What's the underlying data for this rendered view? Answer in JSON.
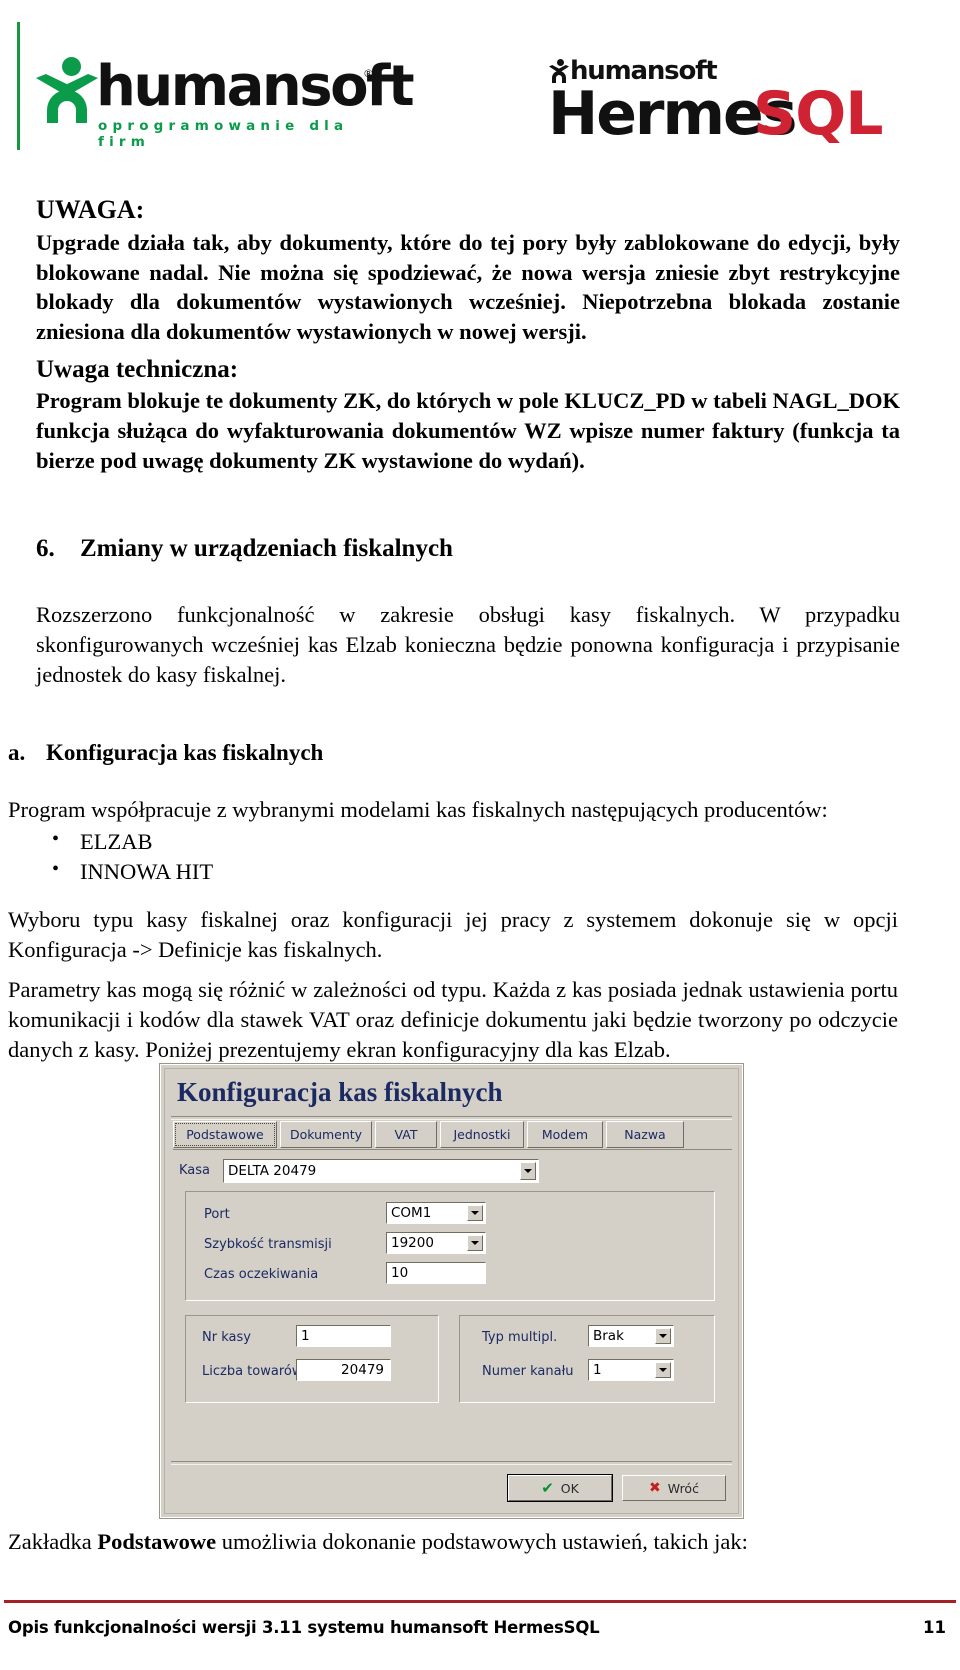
{
  "header": {
    "logo_left": {
      "wordmark": "humansoft",
      "registered_mark": "®",
      "tagline": "oprogramowanie dla firm",
      "figure_icon": "humansoft-person-icon"
    },
    "logo_right": {
      "top_wordmark": "humansoft",
      "product_name_black": "Hermes",
      "product_name_red": "SQL",
      "red_hex": "#cf2233"
    },
    "accent_green_hex": "#0a9b4b"
  },
  "sections": {
    "uwaga": {
      "label": "UWAGA:",
      "body": "Upgrade działa tak, aby dokumenty, które do tej pory były zablokowane do edycji, były blokowane nadal. Nie można się spodziewać, że nowa wersja zniesie zbyt restrykcyjne blokady dla dokumentów wystawionych wcześniej. Niepotrzebna blokada zostanie zniesiona dla dokumentów wystawionych w nowej wersji."
    },
    "uwaga_techniczna": {
      "label": "Uwaga techniczna:",
      "body": "Program blokuje te dokumenty ZK, do których w pole KLUCZ_PD w tabeli NAGL_DOK funkcja służąca do wyfakturowania dokumentów WZ wpisze numer faktury (funkcja ta bierze pod uwagę dokumenty ZK wystawione do wydań)."
    },
    "section6": {
      "number": "6.",
      "title": "Zmiany w urządzeniach fiskalnych",
      "body": "Rozszerzono funkcjonalność w zakresie obsługi kasy fiskalnych. W przypadku skonfigurowanych wcześniej kas Elzab konieczna będzie ponowna konfiguracja i przypisanie jednostek do kasy fiskalnej."
    },
    "section_a": {
      "number": "a.",
      "title": "Konfiguracja kas fiskalnych",
      "intro": "Program współpracuje z wybranymi modelami kas fiskalnych następujących producentów:",
      "bullets": [
        "ELZAB",
        "INNOWA HIT"
      ],
      "para2": "Wyboru typu kasy fiskalnej oraz konfiguracji jej pracy z systemem dokonuje się w opcji Konfiguracja -> Definicje kas fiskalnych.",
      "para3": "Parametry kas mogą się różnić w zależności od typu. Każda z kas posiada jednak ustawienia portu komunikacji i kodów dla stawek VAT oraz definicje dokumentu jaki będzie tworzony po odczycie danych z kasy. Poniżej prezentujemy ekran konfiguracyjny dla kas Elzab."
    },
    "tail": {
      "prefix": "Zakładka ",
      "bold": "Podstawowe",
      "suffix": " umożliwia dokonanie podstawowych ustawień, takich jak:"
    }
  },
  "dialog": {
    "title": "Konfiguracja kas fiskalnych",
    "title_color_hex": "#1b2a62",
    "background_hex": "#d4d0c8",
    "tabs": [
      {
        "label": "Podstawowe",
        "active": true
      },
      {
        "label": "Dokumenty",
        "active": false
      },
      {
        "label": "VAT",
        "active": false
      },
      {
        "label": "Jednostki",
        "active": false
      },
      {
        "label": "Modem",
        "active": false
      },
      {
        "label": "Nazwa",
        "active": false
      }
    ],
    "fields": {
      "kasa": {
        "label": "Kasa",
        "value": "DELTA 20479",
        "control": "combobox"
      },
      "port": {
        "label": "Port",
        "value": "COM1",
        "control": "combobox"
      },
      "szybkosc": {
        "label": "Szybkość transmisji",
        "value": "19200",
        "control": "combobox"
      },
      "czas": {
        "label": "Czas oczekiwania",
        "value": "10",
        "control": "textbox"
      },
      "nr_kasy": {
        "label": "Nr kasy",
        "value": "1",
        "control": "textbox"
      },
      "liczba_towarow": {
        "label": "Liczba towarów",
        "value": "20479",
        "control": "textbox"
      },
      "typ_multipl": {
        "label": "Typ multipl.",
        "value": "Brak",
        "control": "combobox"
      },
      "numer_kanalu": {
        "label": "Numer kanału",
        "value": "1",
        "control": "combobox"
      }
    },
    "buttons": {
      "ok": {
        "label": "OK",
        "icon": "check-icon",
        "icon_color_hex": "#0a8f2e"
      },
      "back": {
        "label": "Wróć",
        "icon": "x-icon",
        "icon_color_hex": "#c42020"
      }
    }
  },
  "footer": {
    "text": "Opis funkcjonalności wersji 3.11 systemu humansoft HermesSQL",
    "page_number": "11",
    "rule_color_hex": "#a42128"
  }
}
